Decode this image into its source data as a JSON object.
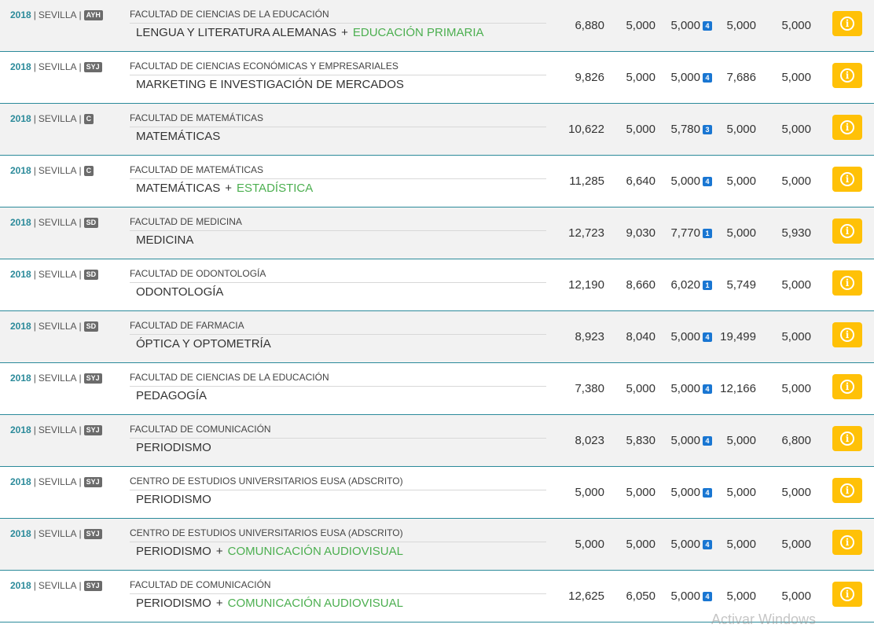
{
  "rows": [
    {
      "year": "2018",
      "city": "SEVILLA",
      "badge": "AYH",
      "faculty": "FACULTAD DE CIENCIAS DE LA EDUCACIÓN",
      "degree": "LENGUA Y LITERATURA ALEMANAS",
      "degree2": "EDUCACIÓN PRIMARIA",
      "v1": "6,880",
      "v2": "5,000",
      "v3": "5,000",
      "rank": "4",
      "v4": "5,000",
      "v5": "5,000"
    },
    {
      "year": "2018",
      "city": "SEVILLA",
      "badge": "SYJ",
      "faculty": "FACULTAD DE CIENCIAS ECONÓMICAS Y EMPRESARIALES",
      "degree": "MARKETING E INVESTIGACIÓN DE MERCADOS",
      "degree2": "",
      "v1": "9,826",
      "v2": "5,000",
      "v3": "5,000",
      "rank": "4",
      "v4": "7,686",
      "v5": "5,000"
    },
    {
      "year": "2018",
      "city": "SEVILLA",
      "badge": "C",
      "faculty": "FACULTAD DE MATEMÁTICAS",
      "degree": "MATEMÁTICAS",
      "degree2": "",
      "v1": "10,622",
      "v2": "5,000",
      "v3": "5,780",
      "rank": "3",
      "v4": "5,000",
      "v5": "5,000"
    },
    {
      "year": "2018",
      "city": "SEVILLA",
      "badge": "C",
      "faculty": "FACULTAD DE MATEMÁTICAS",
      "degree": "MATEMÁTICAS",
      "degree2": "ESTADÍSTICA",
      "v1": "11,285",
      "v2": "6,640",
      "v3": "5,000",
      "rank": "4",
      "v4": "5,000",
      "v5": "5,000"
    },
    {
      "year": "2018",
      "city": "SEVILLA",
      "badge": "SD",
      "faculty": "FACULTAD DE MEDICINA",
      "degree": "MEDICINA",
      "degree2": "",
      "v1": "12,723",
      "v2": "9,030",
      "v3": "7,770",
      "rank": "1",
      "v4": "5,000",
      "v5": "5,930"
    },
    {
      "year": "2018",
      "city": "SEVILLA",
      "badge": "SD",
      "faculty": "FACULTAD DE ODONTOLOGÍA",
      "degree": "ODONTOLOGÍA",
      "degree2": "",
      "v1": "12,190",
      "v2": "8,660",
      "v3": "6,020",
      "rank": "1",
      "v4": "5,749",
      "v5": "5,000"
    },
    {
      "year": "2018",
      "city": "SEVILLA",
      "badge": "SD",
      "faculty": "FACULTAD DE FARMACIA",
      "degree": "ÓPTICA Y OPTOMETRÍA",
      "degree2": "",
      "v1": "8,923",
      "v2": "8,040",
      "v3": "5,000",
      "rank": "4",
      "v4": "19,499",
      "v5": "5,000"
    },
    {
      "year": "2018",
      "city": "SEVILLA",
      "badge": "SYJ",
      "faculty": "FACULTAD DE CIENCIAS DE LA EDUCACIÓN",
      "degree": "PEDAGOGÍA",
      "degree2": "",
      "v1": "7,380",
      "v2": "5,000",
      "v3": "5,000",
      "rank": "4",
      "v4": "12,166",
      "v5": "5,000"
    },
    {
      "year": "2018",
      "city": "SEVILLA",
      "badge": "SYJ",
      "faculty": "FACULTAD DE COMUNICACIÓN",
      "degree": "PERIODISMO",
      "degree2": "",
      "v1": "8,023",
      "v2": "5,830",
      "v3": "5,000",
      "rank": "4",
      "v4": "5,000",
      "v5": "6,800"
    },
    {
      "year": "2018",
      "city": "SEVILLA",
      "badge": "SYJ",
      "faculty": "CENTRO DE ESTUDIOS UNIVERSITARIOS EUSA (ADSCRITO)",
      "degree": "PERIODISMO",
      "degree2": "",
      "v1": "5,000",
      "v2": "5,000",
      "v3": "5,000",
      "rank": "4",
      "v4": "5,000",
      "v5": "5,000"
    },
    {
      "year": "2018",
      "city": "SEVILLA",
      "badge": "SYJ",
      "faculty": "CENTRO DE ESTUDIOS UNIVERSITARIOS EUSA (ADSCRITO)",
      "degree": "PERIODISMO",
      "degree2": "COMUNICACIÓN AUDIOVISUAL",
      "v1": "5,000",
      "v2": "5,000",
      "v3": "5,000",
      "rank": "4",
      "v4": "5,000",
      "v5": "5,000"
    },
    {
      "year": "2018",
      "city": "SEVILLA",
      "badge": "SYJ",
      "faculty": "FACULTAD DE COMUNICACIÓN",
      "degree": "PERIODISMO",
      "degree2": "COMUNICACIÓN AUDIOVISUAL",
      "v1": "12,625",
      "v2": "6,050",
      "v3": "5,000",
      "rank": "4",
      "v4": "5,000",
      "v5": "5,000"
    }
  ],
  "separator": "|",
  "plus_sign": "+",
  "info_icon_glyph": "i",
  "colors": {
    "year": "#2b8a9a",
    "second_degree": "#4caf50",
    "info_button": "#ffc107",
    "rank_badge": "#1976d2"
  },
  "watermark": "Activar Windows"
}
